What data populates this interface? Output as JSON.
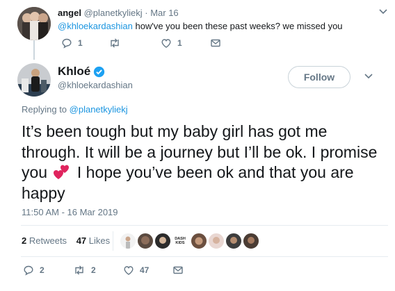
{
  "reply": {
    "name": "angel",
    "handle": "@planetkyliekj",
    "separator": "·",
    "date": "Mar 16",
    "mention": "@khloekardashian",
    "text": " how've you been these past weeks? we missed you",
    "counts": {
      "replies": "1",
      "retweets": "",
      "likes": "1"
    }
  },
  "tweet": {
    "name": "Khloé",
    "handle": "@khloekardashian",
    "follow_label": "Follow",
    "replying_prefix": "Replying to ",
    "replying_handle": "@planetkyliekj",
    "text_part1": "It’s been tough but my baby girl has got me through. It will be a journey but I’ll be ok. I promise you ",
    "text_part2": " I hope you’ve been ok and that you are happy",
    "timestamp": "11:50 AM - 16 Mar 2019",
    "stats": {
      "retweets_count": "2",
      "retweets_label": "Retweets",
      "likes_count": "47",
      "likes_label": "Likes"
    },
    "liker_badge_line1": "DASH",
    "liker_badge_line2": "KIDS",
    "counts": {
      "replies": "2",
      "retweets": "2",
      "likes": "47"
    }
  },
  "colors": {
    "verified": "#1da1f2",
    "link": "#1b95e0",
    "heart": "#e0245e"
  }
}
